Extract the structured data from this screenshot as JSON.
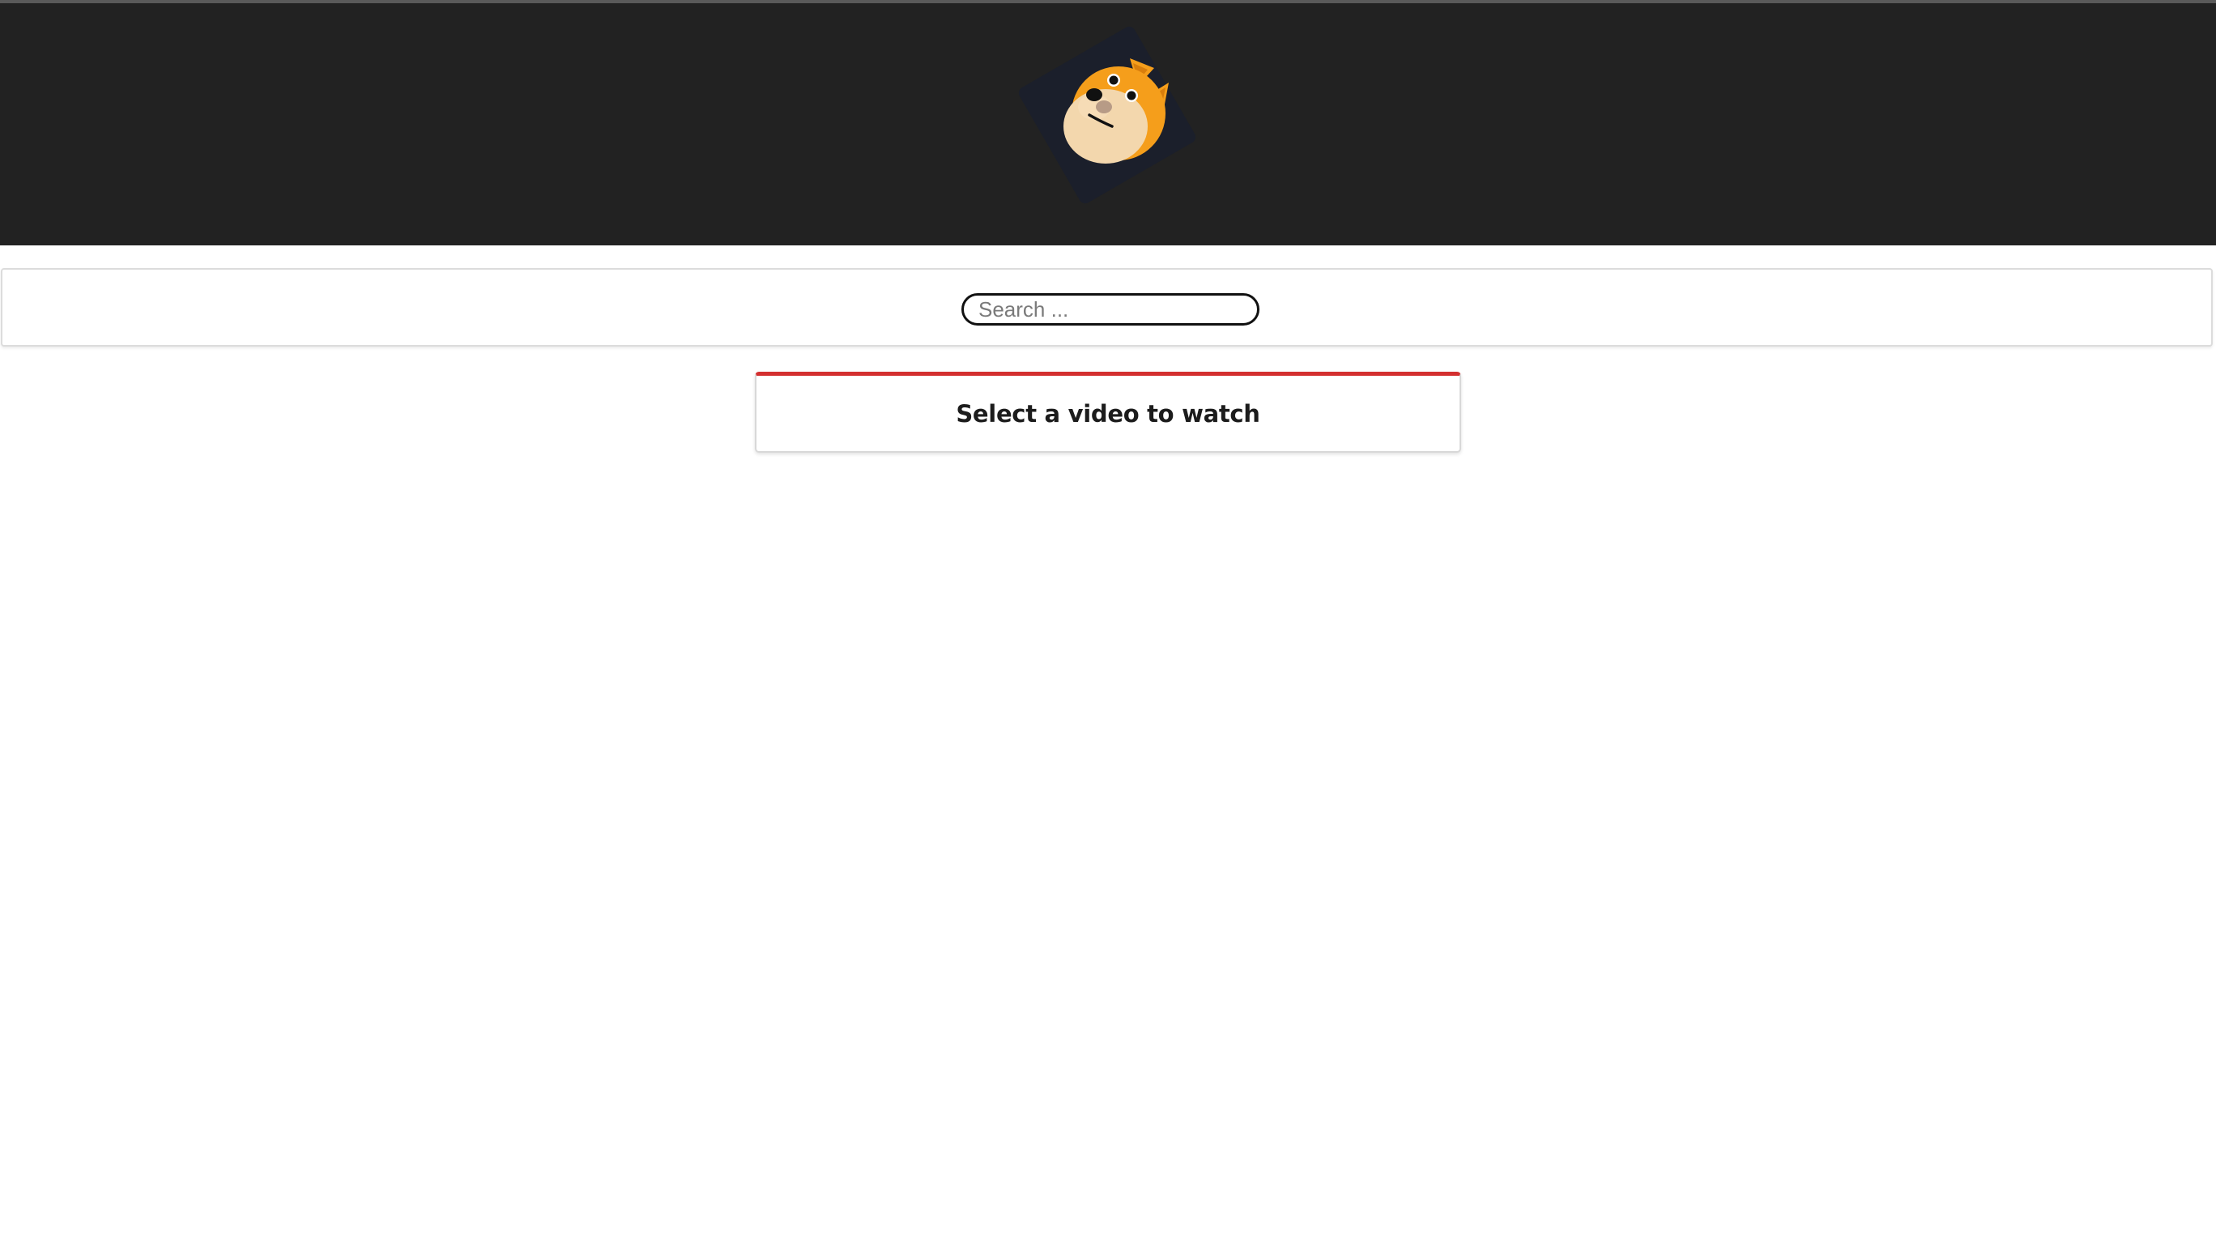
{
  "header": {
    "logo_icon": "doge-dog-logo-icon",
    "background_color": "#222222"
  },
  "search": {
    "placeholder": "Search ..."
  },
  "main": {
    "card_title": "Select a video to watch",
    "card_accent_color": "#d32f2f"
  }
}
